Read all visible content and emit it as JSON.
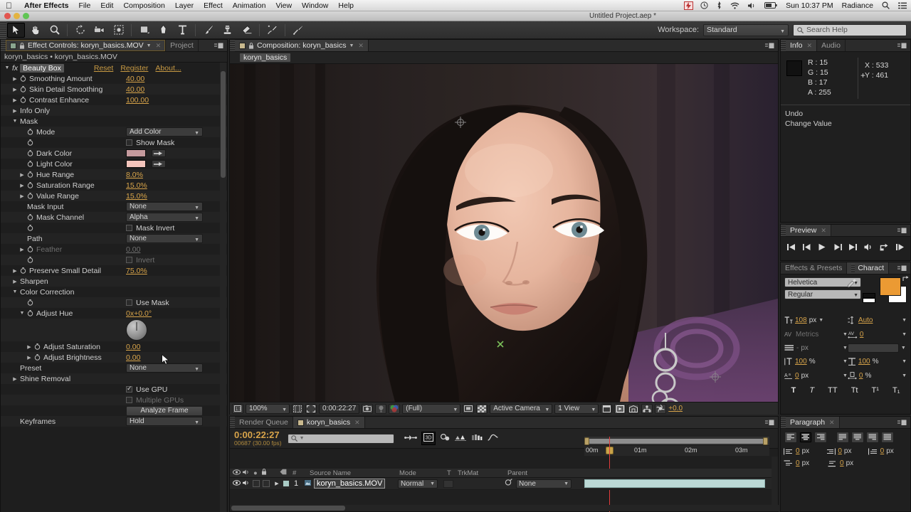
{
  "macbar": {
    "apple": "apple-logo",
    "app_name": "After Effects",
    "menus": [
      "File",
      "Edit",
      "Composition",
      "Layer",
      "Effect",
      "Animation",
      "View",
      "Window",
      "Help"
    ],
    "clock": "Sun 10:37 PM",
    "user": "Radiance",
    "right_icons": [
      "battery-warning-icon",
      "timemachine-icon",
      "bluetooth-icon",
      "wifi-icon",
      "volume-icon",
      "battery-icon",
      "spotlight-icon",
      "notification-center-icon"
    ]
  },
  "window": {
    "title": "Untitled Project.aep *"
  },
  "toolbar": {
    "tools": [
      {
        "name": "selection-tool",
        "active": true
      },
      {
        "name": "hand-tool",
        "active": false
      },
      {
        "name": "zoom-tool",
        "active": false
      },
      {
        "name": "rotation-tool",
        "active": false
      },
      {
        "name": "camera-tool",
        "active": false
      },
      {
        "name": "pan-behind-tool",
        "active": false
      },
      {
        "name": "shape-tool",
        "active": false
      },
      {
        "name": "pen-tool",
        "active": false
      },
      {
        "name": "type-tool",
        "active": false
      },
      {
        "name": "brush-tool",
        "active": false
      },
      {
        "name": "clone-stamp-tool",
        "active": false
      },
      {
        "name": "eraser-tool",
        "active": false
      },
      {
        "name": "roto-brush-tool",
        "active": false
      },
      {
        "name": "puppet-pin-tool",
        "active": false
      }
    ],
    "workspace_label": "Workspace:",
    "workspace_value": "Standard",
    "search_placeholder": "Search Help"
  },
  "effect_controls": {
    "tab_label": "Effect Controls: koryn_basics.MOV",
    "tab2_label": "Project",
    "breadcrumb": "koryn_basics • koryn_basics.MOV",
    "effect_name": "Beauty Box",
    "links": [
      "Reset",
      "Register",
      "About..."
    ],
    "params": [
      {
        "label": "Smoothing Amount",
        "value": "40.00",
        "type": "value",
        "indent": 1,
        "tri": "closed",
        "stopwatch": true
      },
      {
        "label": "Skin Detail Smoothing",
        "value": "40.00",
        "type": "value",
        "indent": 1,
        "tri": "closed",
        "stopwatch": true
      },
      {
        "label": "Contrast Enhance",
        "value": "100.00",
        "type": "value",
        "indent": 1,
        "tri": "closed",
        "stopwatch": true
      },
      {
        "label": "Info Only",
        "value": "",
        "type": "group",
        "indent": 1,
        "tri": "closed",
        "stopwatch": false
      },
      {
        "label": "Mask",
        "value": "",
        "type": "group",
        "indent": 1,
        "tri": "open",
        "stopwatch": false
      },
      {
        "label": "Mode",
        "value": "Add Color",
        "type": "dropdown",
        "indent": 2,
        "tri": "none",
        "stopwatch": true
      },
      {
        "label": "",
        "value": "Show Mask",
        "type": "checkbox",
        "checked": false,
        "indent": 2,
        "tri": "none",
        "stopwatch": true
      },
      {
        "label": "Dark Color",
        "value": "#c49a9d",
        "type": "color",
        "indent": 2,
        "tri": "none",
        "stopwatch": true
      },
      {
        "label": "Light Color",
        "value": "#f3c4bb",
        "type": "color",
        "indent": 2,
        "tri": "none",
        "stopwatch": true
      },
      {
        "label": "Hue Range",
        "value": "8.0%",
        "type": "value",
        "indent": 2,
        "tri": "closed",
        "stopwatch": true
      },
      {
        "label": "Saturation Range",
        "value": "15.0%",
        "type": "value",
        "indent": 2,
        "tri": "closed",
        "stopwatch": true
      },
      {
        "label": "Value Range",
        "value": "15.0%",
        "type": "value",
        "indent": 2,
        "tri": "closed",
        "stopwatch": true
      },
      {
        "label": "Mask Input",
        "value": "None",
        "type": "dropdown",
        "indent": 2,
        "tri": "none",
        "stopwatch": false
      },
      {
        "label": "Mask Channel",
        "value": "Alpha",
        "type": "dropdown",
        "indent": 2,
        "tri": "none",
        "stopwatch": true
      },
      {
        "label": "",
        "value": "Mask Invert",
        "type": "checkbox",
        "checked": false,
        "indent": 2,
        "tri": "none",
        "stopwatch": true
      },
      {
        "label": "Path",
        "value": "None",
        "type": "dropdown",
        "indent": 2,
        "tri": "none",
        "stopwatch": false
      },
      {
        "label": "Feather",
        "value": "0.00",
        "type": "value",
        "indent": 2,
        "tri": "closed",
        "stopwatch": true,
        "disabled": true
      },
      {
        "label": "",
        "value": "Invert",
        "type": "checkbox",
        "checked": false,
        "indent": 2,
        "tri": "none",
        "stopwatch": true,
        "disabled": true
      },
      {
        "label": "Preserve Small Detail",
        "value": "75.0%",
        "type": "value",
        "indent": 1,
        "tri": "closed",
        "stopwatch": true
      },
      {
        "label": "Sharpen",
        "value": "",
        "type": "group",
        "indent": 1,
        "tri": "closed",
        "stopwatch": false
      },
      {
        "label": "Color Correction",
        "value": "",
        "type": "group",
        "indent": 1,
        "tri": "open",
        "stopwatch": false
      },
      {
        "label": "",
        "value": "Use Mask",
        "type": "checkbox",
        "checked": false,
        "indent": 2,
        "tri": "none",
        "stopwatch": true
      },
      {
        "label": "Adjust Hue",
        "value": "0x+0.0°",
        "type": "value",
        "indent": 2,
        "tri": "open",
        "stopwatch": true
      },
      {
        "label": "",
        "value": "",
        "type": "dial",
        "indent": 2,
        "tri": "none",
        "stopwatch": false
      },
      {
        "label": "Adjust Saturation",
        "value": "0.00",
        "type": "value",
        "indent": 3,
        "tri": "closed",
        "stopwatch": true
      },
      {
        "label": "Adjust Brightness",
        "value": "0.00",
        "type": "value",
        "indent": 3,
        "tri": "closed",
        "stopwatch": true
      },
      {
        "label": "Preset",
        "value": "None",
        "type": "dropdown",
        "indent": 1,
        "tri": "none",
        "stopwatch": false
      },
      {
        "label": "Shine Removal",
        "value": "",
        "type": "group",
        "indent": 1,
        "tri": "closed",
        "stopwatch": false
      },
      {
        "label": "",
        "value": "Use GPU",
        "type": "checkbox",
        "checked": true,
        "indent": 2,
        "tri": "none",
        "stopwatch": false
      },
      {
        "label": "",
        "value": "Multiple GPUs",
        "type": "checkbox",
        "checked": false,
        "indent": 2,
        "tri": "none",
        "stopwatch": false,
        "disabled": true
      },
      {
        "label": "",
        "value": "Analyze Frame",
        "type": "button",
        "indent": 2,
        "tri": "none",
        "stopwatch": false
      },
      {
        "label": "Keyframes",
        "value": "Hold",
        "type": "dropdown",
        "indent": 1,
        "tri": "none",
        "stopwatch": false
      }
    ]
  },
  "composition": {
    "tab_label": "Composition: koryn_basics",
    "breadcrumb": "koryn_basics",
    "bottom_bar": {
      "zoom": "100%",
      "time": "0:00:22:27",
      "resolution": "(Full)",
      "camera": "Active Camera",
      "views": "1 View",
      "exposure": "+0.0"
    }
  },
  "timeline": {
    "tab_render_queue": "Render Queue",
    "tab_comp": "koryn_basics",
    "current_time": "0:00:22:27",
    "frame_info": "00687 (30.00 fps)",
    "search_placeholder": "",
    "ruler_labels": [
      "00m",
      "01m",
      "02m",
      "03m"
    ],
    "columns": [
      "#",
      "Source Name",
      "Mode",
      "T",
      "TrkMat",
      "Parent"
    ],
    "rows": [
      {
        "index": "1",
        "source": "koryn_basics.MOV",
        "mode": "Normal",
        "trkmat": "",
        "parent": "None"
      }
    ]
  },
  "info_panel": {
    "tab_label": "Info",
    "tab2_label": "Audio",
    "r_label": "R :",
    "r": "15",
    "g_label": "G :",
    "g": "15",
    "b_label": "B :",
    "b": "17",
    "a_label": "A :",
    "a": "255",
    "x_label": "X :",
    "x": "533",
    "y_label": "Y :",
    "y": "461",
    "undo_label": "Undo",
    "undo_action": "Change Value",
    "swatch_color": "#0f0f11"
  },
  "preview_panel": {
    "tab_label": "Preview",
    "buttons": [
      "first-frame-icon",
      "previous-frame-icon",
      "play-icon",
      "next-frame-icon",
      "last-frame-icon",
      "audio-icon",
      "loop-icon",
      "ram-preview-icon"
    ]
  },
  "character_panel": {
    "tab_effects_label": "Effects & Presets",
    "tab_label": "Charact",
    "font_family": "Helvetica",
    "font_style": "Regular",
    "font_size": "108",
    "font_size_unit": "px",
    "leading": "Auto",
    "kerning_label": "Metrics",
    "tracking": "0",
    "stroke_width": "-",
    "stroke_width_unit": "px",
    "vertical_scale": "100",
    "vertical_scale_unit": "%",
    "horizontal_scale": "100",
    "horizontal_scale_unit": "%",
    "baseline_shift": "0",
    "baseline_shift_unit": "px",
    "tsume": "0",
    "tsume_unit": "%",
    "fill_color": "#eb9a33",
    "styles": [
      "T",
      "T",
      "TT",
      "Tt",
      "T¹",
      "T₁"
    ]
  },
  "paragraph_panel": {
    "tab_label": "Paragraph",
    "align_buttons": [
      "align-left-icon",
      "align-center-icon",
      "align-right-icon",
      "justify-last-left-icon",
      "justify-last-center-icon",
      "justify-last-right-icon",
      "justify-all-icon"
    ],
    "active_align": 1,
    "indents": [
      {
        "name": "indent-left",
        "value": "0",
        "unit": "px"
      },
      {
        "name": "indent-right",
        "value": "0",
        "unit": "px"
      },
      {
        "name": "indent-first-line",
        "value": "0",
        "unit": "px"
      },
      {
        "name": "space-before",
        "value": "0",
        "unit": "px"
      },
      {
        "name": "space-after",
        "value": "0",
        "unit": "px"
      }
    ]
  }
}
